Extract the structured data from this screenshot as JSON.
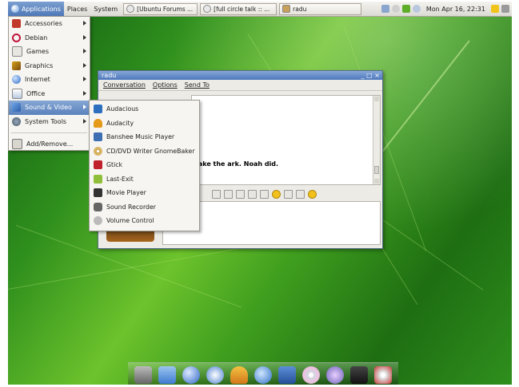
{
  "top_panel": {
    "menus": [
      "Applications",
      "Places",
      "System"
    ],
    "tasks": [
      "[Ubuntu Forums ...",
      "[full circle talk :: ...",
      "radu"
    ],
    "clock": "Mon Apr 16, 22:31"
  },
  "app_menu": {
    "items": [
      {
        "label": "Accessories",
        "icon": "accessories-icon"
      },
      {
        "label": "Debian",
        "icon": "debian-icon"
      },
      {
        "label": "Games",
        "icon": "games-icon"
      },
      {
        "label": "Graphics",
        "icon": "graphics-icon"
      },
      {
        "label": "Internet",
        "icon": "internet-icon"
      },
      {
        "label": "Office",
        "icon": "office-icon"
      },
      {
        "label": "Sound & Video",
        "icon": "sound-video-icon",
        "selected": true
      },
      {
        "label": "System Tools",
        "icon": "system-tools-icon"
      }
    ],
    "footer": "Add/Remove..."
  },
  "submenu": {
    "items": [
      {
        "label": "Audacious",
        "icon": "audacious-icon"
      },
      {
        "label": "Audacity",
        "icon": "audacity-icon"
      },
      {
        "label": "Banshee Music Player",
        "icon": "banshee-icon"
      },
      {
        "label": "CD/DVD Writer GnomeBaker",
        "icon": "disc-icon"
      },
      {
        "label": "Gtick",
        "icon": "gtick-icon"
      },
      {
        "label": "Last-Exit",
        "icon": "last-exit-icon"
      },
      {
        "label": "Movie Player",
        "icon": "movie-player-icon"
      },
      {
        "label": "Sound Recorder",
        "icon": "sound-recorder-icon"
      },
      {
        "label": "Volume Control",
        "icon": "volume-icon"
      }
    ]
  },
  "chat_window": {
    "title": "radu",
    "window_controls": "_ □ ×",
    "menus": [
      "Conversation",
      "Options",
      "Send To"
    ],
    "message": "take the ark. Noah did."
  },
  "dock": {
    "icons": [
      "drive-icon",
      "home-folder-icon",
      "web-browser-icon",
      "banshee-icon",
      "people-icon",
      "water-drop-icon",
      "media-player-icon",
      "cd-icon",
      "pidgin-icon",
      "terminal-icon",
      "cd-writer-icon"
    ]
  },
  "colors": {
    "menu_selected": "#5b82bd",
    "titlebar": "#4d78bd",
    "desktop_green": "#3f9e1e"
  }
}
